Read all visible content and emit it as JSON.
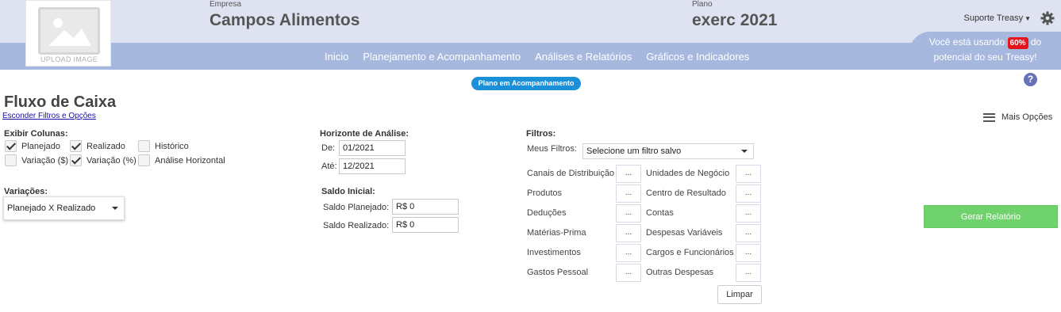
{
  "header": {
    "logo_caption": "UPLOAD IMAGE",
    "company_label": "Empresa",
    "company_name": "Campos Alimentos",
    "plan_label": "Plano",
    "plan_name": "exerc 2021",
    "user_menu": "Suporte Treasy",
    "nav": [
      "Inicio",
      "Planejamento e Acompanhamento",
      "Análises e Relatórios",
      "Gráficos e Indicadores"
    ],
    "usage": {
      "text_before": "Você está usando",
      "percent": "60%",
      "text_after": "do",
      "line2": "potencial do seu Treasy!"
    }
  },
  "status_pill": "Plano em Acompanhamento",
  "page": {
    "title": "Fluxo de Caixa",
    "hide_filters": "Esconder Filtros e Opções",
    "more_options": "Mais Opções"
  },
  "columns": {
    "label": "Exibir Colunas:",
    "items": [
      {
        "label": "Planejado",
        "checked": true
      },
      {
        "label": "Realizado",
        "checked": true
      },
      {
        "label": "Histórico",
        "checked": false
      },
      {
        "label": "Variação ($)",
        "checked": false
      },
      {
        "label": "Variação (%)",
        "checked": true
      },
      {
        "label": "Análise Horizontal",
        "checked": false
      }
    ]
  },
  "variations": {
    "label": "Variações:",
    "selected": "Planejado X Realizado"
  },
  "horizon": {
    "label": "Horizonte de Análise:",
    "from_label": "De:",
    "from_value": "01/2021",
    "to_label": "Até:",
    "to_value": "12/2021"
  },
  "initial_balance": {
    "label": "Saldo Inicial:",
    "planned_label": "Saldo Planejado:",
    "planned_value": "R$ 0",
    "realized_label": "Saldo Realizado:",
    "realized_value": "R$ 0"
  },
  "filters": {
    "label": "Filtros:",
    "my_filters_label": "Meus Filtros:",
    "my_filters_selected": "Selecione um filtro salvo",
    "button_label": "...",
    "left": [
      "Canais de Distribuição",
      "Produtos",
      "Deduções",
      "Matérias-Prima",
      "Investimentos",
      "Gastos Pessoal"
    ],
    "right": [
      "Unidades de Negócio",
      "Centro de Resultado",
      "Contas",
      "Despesas Variáveis",
      "Cargos e Funcionários",
      "Outras Despesas"
    ],
    "clear": "Limpar"
  },
  "generate_report": "Gerar Relatório",
  "colors": {
    "header_top": "#dfe3f1",
    "header_nav": "#a7b8de",
    "pill": "#1a90d9",
    "badge": "#e6151b",
    "generate": "#6fd26c",
    "help": "#6673b8"
  },
  "icons": [
    "image-placeholder-icon",
    "gear-icon",
    "help-icon",
    "hamburger-icon",
    "checkbox-icon",
    "dropdown-arrow-icon"
  ]
}
